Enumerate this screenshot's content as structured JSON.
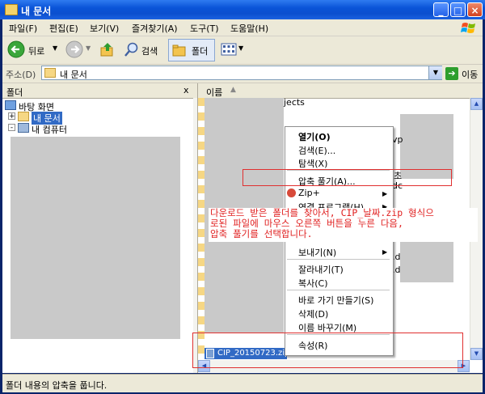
{
  "window": {
    "title": "내 문서"
  },
  "menubar": {
    "items": [
      "파일(F)",
      "편집(E)",
      "보기(V)",
      "즐겨찾기(A)",
      "도구(T)",
      "도움말(H)"
    ]
  },
  "toolbar": {
    "back_label": "뒤로",
    "search_label": "검색",
    "folders_label": "폴더"
  },
  "address": {
    "label": "주소(D)",
    "value": "내 문서",
    "go_label": "이동"
  },
  "left_pane": {
    "header": "폴더",
    "close_glyph": "x",
    "tree": [
      {
        "label": "바탕 화면"
      },
      {
        "label": "내 문서",
        "expander": "+"
      },
      {
        "label": "내 컴퓨터",
        "expander": "-"
      }
    ]
  },
  "right_pane": {
    "column_header": "이름",
    "visible_text": "jects",
    "fragments": [
      "vp",
      "초",
      "dc",
      ".d",
      ".d"
    ],
    "zip_file": "CIP_20150723.zip"
  },
  "context_menu": {
    "items": [
      {
        "label": "열기(O)",
        "bold": true
      },
      {
        "label": "검색(E)..."
      },
      {
        "label": "탐색(X)"
      },
      {
        "label": "압축 풀기(A)..."
      },
      {
        "label": "Zip+",
        "submenu": true
      },
      {
        "label": "연결 프로그램(H)",
        "submenu": true
      },
      {
        "label": "보내기(N)",
        "submenu": true
      },
      {
        "label": "잘라내기(T)"
      },
      {
        "label": "복사(C)"
      },
      {
        "label": "바로 가기 만들기(S)"
      },
      {
        "label": "삭제(D)"
      },
      {
        "label": "이름 바꾸기(M)"
      },
      {
        "label": "속성(R)"
      }
    ]
  },
  "annotation": {
    "line1": "다운로드 받은 폴더를 찾아서, CIP_날짜.zip 형식으",
    "line2": "로된 파일에 마우스 오른쪽 버튼을 누른 다음,",
    "line3": "압축 풀기를 선택합니다.",
    "color": "#e02020"
  },
  "status": {
    "text": "폴더 내용의 압축을 풉니다."
  },
  "colors": {
    "selection": "#316ac5",
    "titlebar": "#0a54d8",
    "annotation_box": "#e03030"
  }
}
